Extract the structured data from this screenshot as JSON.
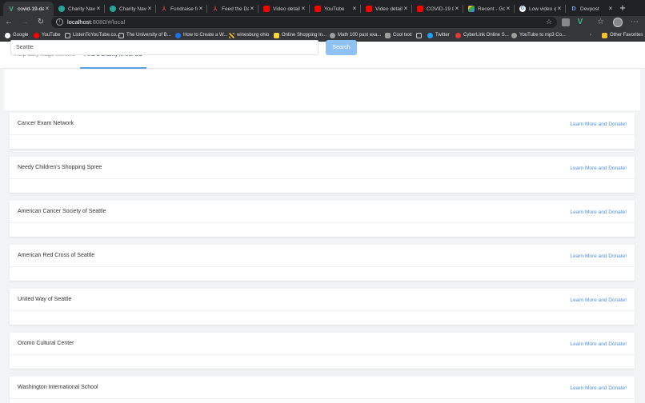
{
  "browser": {
    "tabs": [
      {
        "title": "covid-19-dai",
        "icon": "v-logo-icon",
        "color": "#41b883",
        "active": true
      },
      {
        "title": "Charity Navig",
        "icon": "charity-navigator-icon",
        "color": "#26a69a"
      },
      {
        "title": "Charity Navig",
        "icon": "charity-navigator-icon",
        "color": "#26a69a"
      },
      {
        "title": "Fundraise for",
        "icon": "devpost-icon",
        "color": "#e8453c"
      },
      {
        "title": "Feed the Daily",
        "icon": "devpost-icon",
        "color": "#e8453c"
      },
      {
        "title": "Video details",
        "icon": "youtube-studio-icon",
        "color": "#ff0000"
      },
      {
        "title": "YouTube",
        "icon": "youtube-icon",
        "color": "#ff0000"
      },
      {
        "title": "Video details",
        "icon": "youtube-studio-icon",
        "color": "#ff0000"
      },
      {
        "title": "COVID-19 Ch",
        "icon": "youtube-icon",
        "color": "#ff0000"
      },
      {
        "title": "Recent - Goo",
        "icon": "google-drive-icon",
        "color": "#34a853"
      },
      {
        "title": "Low video qu",
        "icon": "google-icon",
        "color": "#ffffff"
      },
      {
        "title": "Devpost",
        "icon": "devpost-d-icon",
        "color": "#1a73e8"
      }
    ],
    "url_host": "localhost",
    "url_rest": ":8080/#/local",
    "bookmarks": [
      {
        "label": "Google",
        "color": "#ffffff"
      },
      {
        "label": "YouTube",
        "color": "#ff0000"
      },
      {
        "label": "ListenToYouTube.co...",
        "color": "#ffffff"
      },
      {
        "label": "The University of B...",
        "color": "#9e9e9e"
      },
      {
        "label": "How to Create a W...",
        "color": "#1a73e8"
      },
      {
        "label": "winesburg ohio",
        "color": "#fbc02d"
      },
      {
        "label": "Online Shopping In...",
        "color": "#fdd835"
      },
      {
        "label": "Math 100 past exa...",
        "color": "#9e9e9e"
      },
      {
        "label": "Cool text",
        "color": "#9e9e9e"
      },
      {
        "label": "Twitter",
        "color": "#1da1f2"
      },
      {
        "label": "CyberLink Online S...",
        "color": "#e53935"
      },
      {
        "label": "YouTube to mp3 Co...",
        "color": "#9e9e9e"
      }
    ],
    "other_favorites": "Other Favorites"
  },
  "page": {
    "tabs": [
      {
        "label": "Help daily wage workers",
        "active": false
      },
      {
        "label": "Find a charity in the US",
        "active": true
      }
    ],
    "search": {
      "value": "Seattle",
      "button": "Search"
    },
    "link_label": "Learn More and Donate!",
    "charities": [
      {
        "name": "Cancer Exam Network"
      },
      {
        "name": "Needy Children's Shopping Spree"
      },
      {
        "name": "American Cancer Society of Seattle"
      },
      {
        "name": "American Red Cross of Seattle"
      },
      {
        "name": "United Way of Seattle"
      },
      {
        "name": "Oromo Cultural Center"
      },
      {
        "name": "Washington International School"
      }
    ]
  },
  "colors": {
    "accent": "#5b9ee8",
    "button": "#8ec2f5",
    "link": "#4a90e2"
  }
}
